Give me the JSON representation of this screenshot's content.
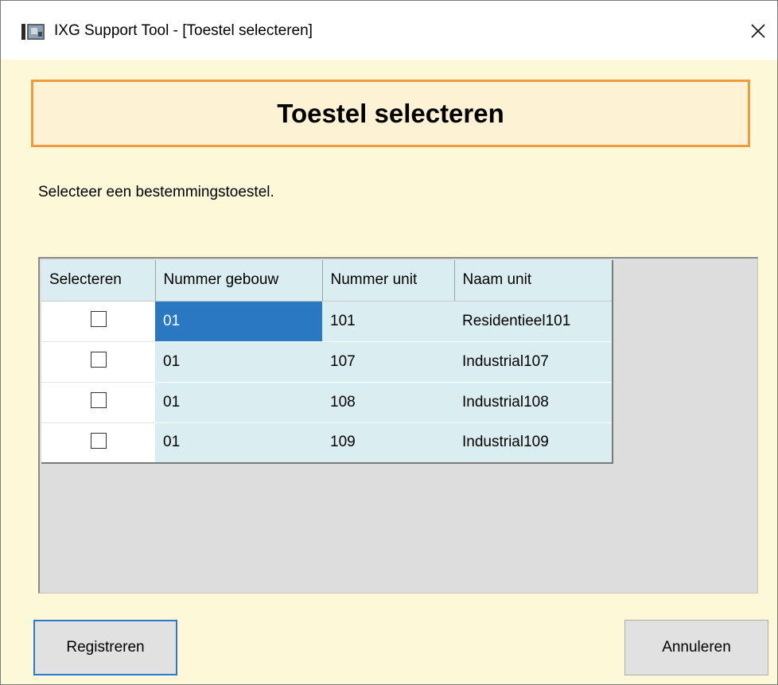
{
  "window": {
    "title": "IXG Support Tool - [Toestel selecteren]",
    "app_icon": "ixg-app-icon",
    "close_glyph": "✕"
  },
  "banner": {
    "title": "Toestel selecteren"
  },
  "instruction": "Selecteer een bestemmingstoestel.",
  "grid": {
    "columns": [
      "Selecteren",
      "Nummer gebouw",
      "Nummer unit",
      "Naam unit"
    ],
    "rows": [
      {
        "checked": false,
        "building": "01",
        "unit": "101",
        "name": "Residentieel101"
      },
      {
        "checked": false,
        "building": "01",
        "unit": "107",
        "name": "Industrial107"
      },
      {
        "checked": false,
        "building": "01",
        "unit": "108",
        "name": "Industrial108"
      },
      {
        "checked": false,
        "building": "01",
        "unit": "109",
        "name": "Industrial109"
      }
    ]
  },
  "buttons": {
    "register": "Registreren",
    "cancel": "Annuleren"
  },
  "colors": {
    "window_bg": "#fdf8d8",
    "banner_border": "#ef9b3c",
    "grid_cell": "#daeef2",
    "selected_cell": "#2a78c2",
    "focus_border": "#2b78d0"
  }
}
